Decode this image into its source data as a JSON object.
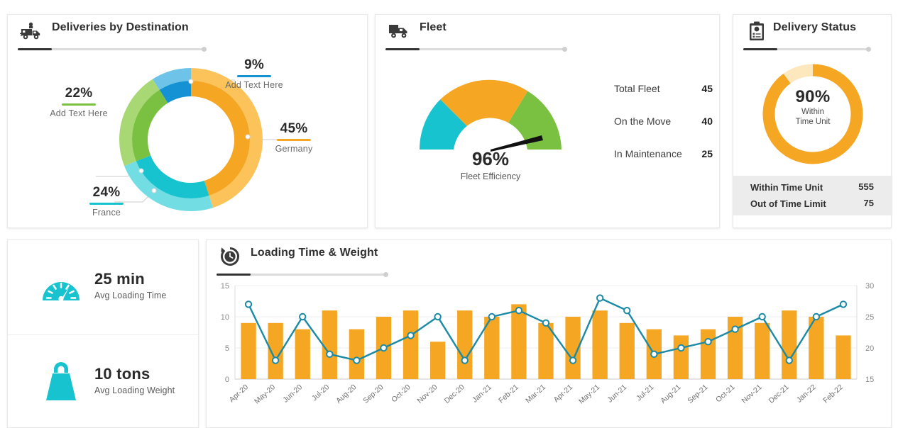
{
  "colors": {
    "orange": "#f5a623",
    "orange_light": "#fcc35a",
    "orange_pale": "#fde7bd",
    "teal": "#17c3ce",
    "teal_light": "#72dde2",
    "green": "#7ac142",
    "green_light": "#a8d873",
    "blue": "#1492d3",
    "blue_light": "#6ec4e8",
    "line_blue": "#1b8aa5",
    "text_dark": "#2a2a2a",
    "text_muted": "#6a6a6a",
    "panel_border": "#e9e9e9",
    "footer_bg": "#ececec"
  },
  "deliveries": {
    "icon": "delivery-truck-icon",
    "title": "Deliveries by Destination",
    "chart_data": {
      "type": "pie",
      "title": "Deliveries by Destination",
      "labels": [
        "Germany",
        "France",
        "Add Text Here",
        "Add Text Here"
      ],
      "values": [
        45,
        24,
        22,
        9
      ],
      "value_suffix": "%",
      "colors": [
        "#f5a623",
        "#17c3ce",
        "#7ac142",
        "#1492d3"
      ],
      "outer_colors": [
        "#fcc35a",
        "#72dde2",
        "#a8d873",
        "#6ec4e8"
      ],
      "legend": "callout-labels"
    },
    "callouts": [
      {
        "pct": "9%",
        "name": "Add Text Here",
        "color": "#1492d3"
      },
      {
        "pct": "22%",
        "name": "Add Text Here",
        "color": "#7ac142"
      },
      {
        "pct": "45%",
        "name": "Germany",
        "color": "#f5a623"
      },
      {
        "pct": "24%",
        "name": "France",
        "color": "#17c3ce"
      }
    ]
  },
  "fleet": {
    "icon": "truck-icon",
    "title": "Fleet",
    "chart_data": {
      "type": "pie",
      "subtype": "gauge",
      "title": "Fleet Efficiency",
      "value": 96,
      "value_label": "96%",
      "unit": "%",
      "segments": [
        {
          "name": "segment-1",
          "share": 40,
          "color": "#17c3ce"
        },
        {
          "name": "segment-2",
          "share": 35,
          "color": "#f5a623"
        },
        {
          "name": "segment-3",
          "share": 25,
          "color": "#7ac142"
        }
      ],
      "needle_angle_deg": 160
    },
    "gauge_value": "96%",
    "gauge_caption": "Fleet Efficiency",
    "stats": [
      {
        "label": "Total Fleet",
        "value": "45"
      },
      {
        "label": "On the Move",
        "value": "40"
      },
      {
        "label": "In Maintenance",
        "value": "25"
      }
    ]
  },
  "status": {
    "icon": "clipboard-icon",
    "title": "Delivery Status",
    "chart_data": {
      "type": "pie",
      "subtype": "donut",
      "title": "Delivery Status",
      "labels": [
        "Within Time Unit",
        "Out of Time Limit"
      ],
      "values": [
        90,
        10
      ],
      "raw_values": [
        555,
        75
      ],
      "colors": [
        "#f5a623",
        "#fde7bd"
      ]
    },
    "ring_value": "90%",
    "ring_line1": "Within",
    "ring_line2": "Time Unit",
    "footer": [
      {
        "label": "Within Time Unit",
        "value": "555"
      },
      {
        "label": "Out of Time Limit",
        "value": "75"
      }
    ]
  },
  "kpis": [
    {
      "icon": "speedometer-icon",
      "value": "25 min",
      "label": "Avg Loading Time",
      "color": "#17c3ce"
    },
    {
      "icon": "weight-bag-icon",
      "value": "10 tons",
      "label": "Avg Loading Weight",
      "color": "#17c3ce"
    }
  ],
  "loading": {
    "icon": "clock-history-icon",
    "title": "Loading Time & Weight",
    "chart_data": {
      "type": "bar",
      "title": "Loading Time & Weight",
      "xlabel": "",
      "ylabel": "",
      "categories": [
        "Apr-20",
        "May-20",
        "Jun-20",
        "Jul-20",
        "Aug-20",
        "Sep-20",
        "Oct-20",
        "Nov-20",
        "Dec-20",
        "Jan-21",
        "Feb-21",
        "Mar-21",
        "Apr-21",
        "May-21",
        "Jun-21",
        "Jul-21",
        "Aug-21",
        "Sep-21",
        "Oct-21",
        "Nov-21",
        "Dec-21",
        "Jan-22",
        "Feb-22"
      ],
      "series": [
        {
          "name": "Loading Weight",
          "type": "bar",
          "axis": "left",
          "color": "#f5a623",
          "values": [
            9,
            9,
            8,
            11,
            8,
            10,
            11,
            6,
            11,
            10,
            12,
            9,
            10,
            11,
            9,
            8,
            7,
            8,
            10,
            9,
            11,
            10,
            7
          ]
        },
        {
          "name": "Loading Time",
          "type": "line",
          "axis": "right",
          "color": "#1b8aa5",
          "marker_fill": "#ffffff",
          "values": [
            27,
            18,
            25,
            19,
            18,
            20,
            22,
            25,
            18,
            25,
            26,
            24,
            18,
            28,
            26,
            19,
            20,
            21,
            23,
            25,
            18,
            25,
            27
          ]
        }
      ],
      "left_axis": {
        "ticks": [
          0,
          5,
          10,
          15
        ],
        "ylim": [
          0,
          15
        ]
      },
      "right_axis": {
        "ticks": [
          15,
          20,
          25,
          30
        ],
        "ylim": [
          15,
          30
        ]
      },
      "grid": "horizontal",
      "legend": "none"
    }
  }
}
